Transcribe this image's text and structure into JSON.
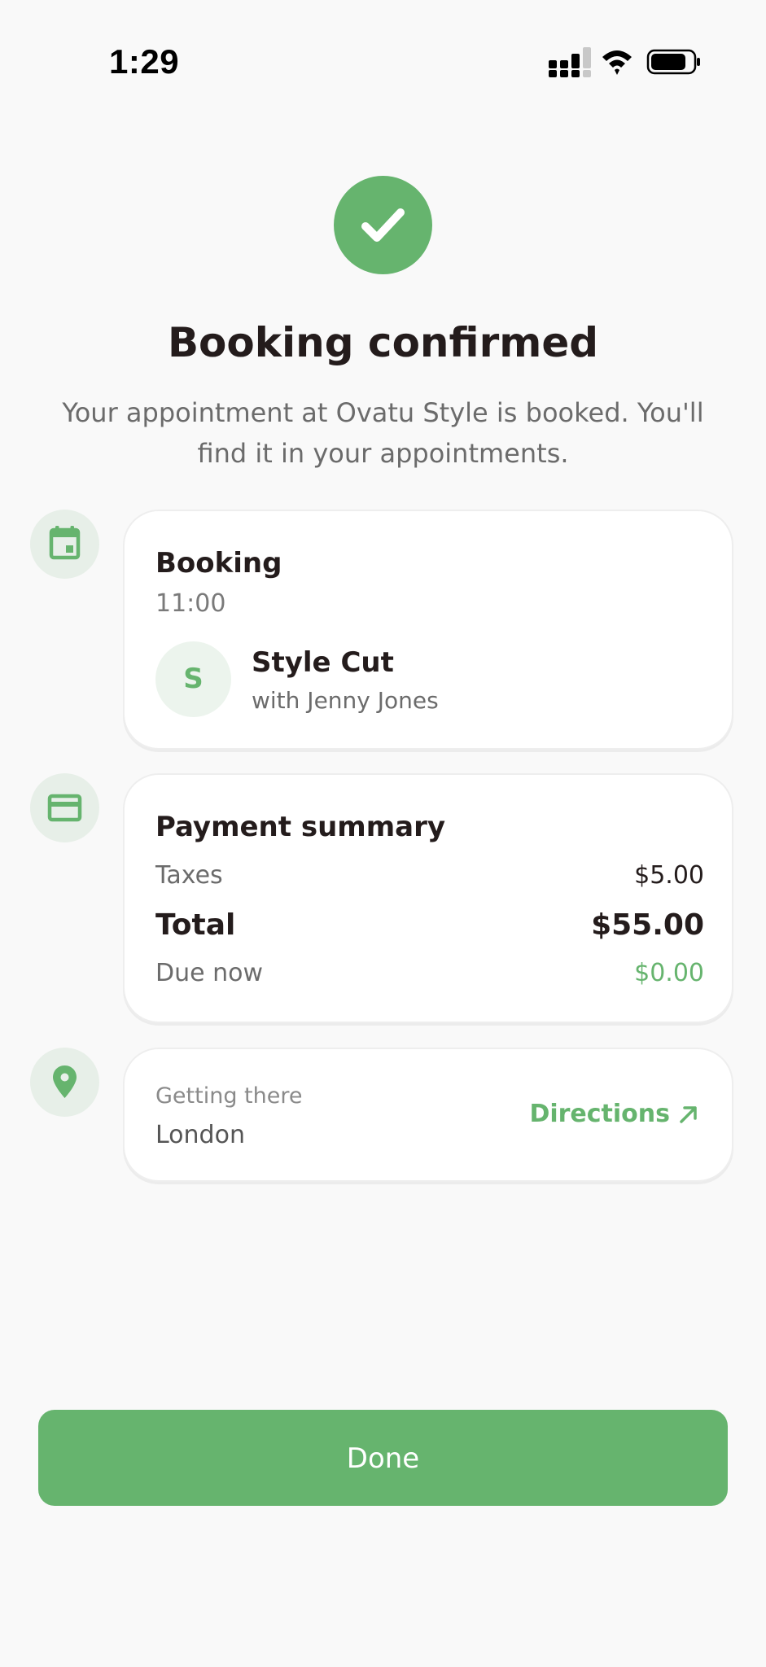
{
  "status_bar": {
    "time": "1:29"
  },
  "confirmation": {
    "title": "Booking confirmed",
    "subtitle": "Your appointment at Ovatu Style is booked. You'll find it in your appointments."
  },
  "booking": {
    "title": "Booking",
    "time": "11:00",
    "avatar_letter": "S",
    "service": "Style Cut",
    "staff": "with Jenny Jones"
  },
  "payment": {
    "title": "Payment summary",
    "rows": [
      {
        "label": "Taxes",
        "value": "$5.00"
      },
      {
        "label": "Total",
        "value": "$55.00"
      },
      {
        "label": "Due now",
        "value": "$0.00"
      }
    ]
  },
  "location": {
    "label": "Getting there",
    "city": "London",
    "directions_label": "Directions"
  },
  "actions": {
    "done_label": "Done"
  },
  "colors": {
    "accent": "#66b46e",
    "icon_bg": "#e7efe8",
    "text_primary": "#241c1c",
    "text_secondary": "#6b6b6b"
  },
  "icons": {
    "booking": "calendar-icon",
    "payment": "credit-card-icon",
    "location": "map-pin-icon",
    "success": "checkmark-icon",
    "directions": "arrow-up-right-icon"
  }
}
